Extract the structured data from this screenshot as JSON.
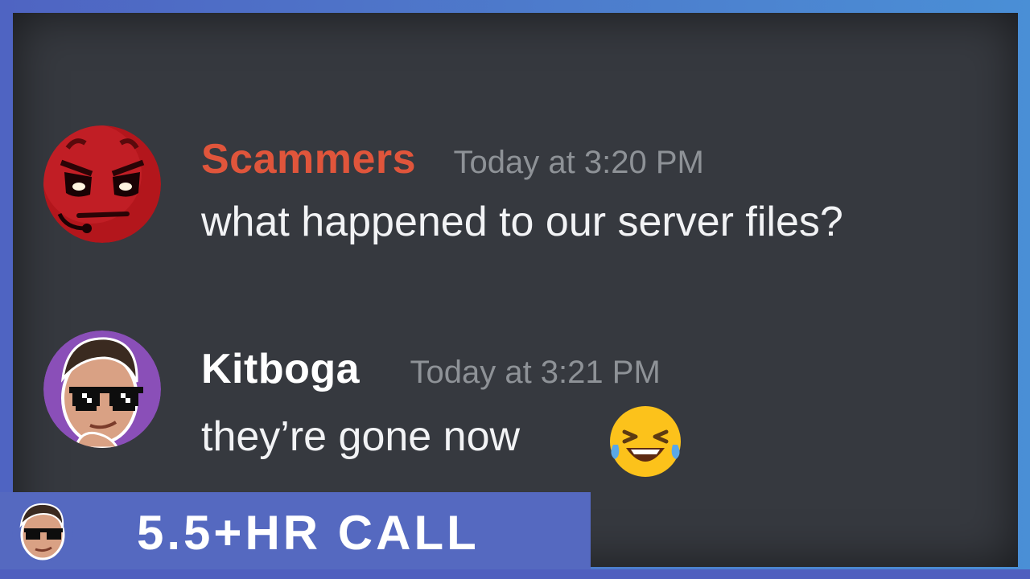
{
  "messages": [
    {
      "username": "Scammers",
      "timestamp": "Today at 3:20 PM",
      "text": "what happened to our server files?",
      "avatar_icon": "devil-face-icon",
      "name_color": "#e0553b"
    },
    {
      "username": "Kitboga",
      "timestamp": "Today at 3:21 PM",
      "text": "they’re gone now",
      "avatar_icon": "kitboga-avatar-icon",
      "emoji_icon": "laughing-tears-emoji-icon",
      "name_color": "#ffffff"
    }
  ],
  "banner": {
    "title": "5.5+HR CALL",
    "avatar_icon": "kitboga-avatar-icon"
  },
  "colors": {
    "panel_bg": "#36393f",
    "frame": "#4f64c2",
    "banner_bg": "#5569c0",
    "timestamp": "#8e9297"
  }
}
